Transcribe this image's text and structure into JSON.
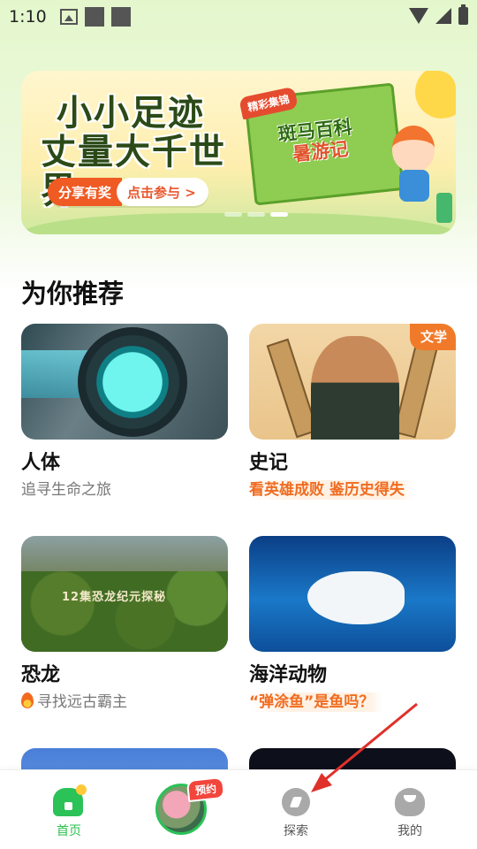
{
  "status_bar": {
    "time": "1:10"
  },
  "banner": {
    "title_line1": "小小足迹",
    "title_line2": "丈量大千世界",
    "share_label": "分享有奖",
    "join_label": "点击参与 >",
    "badge": "精彩集锦",
    "map_title_line1": "斑马百科",
    "map_title_line2": "暑游记",
    "slide_count": 3,
    "active_slide": 3
  },
  "section": {
    "title": "为你推荐"
  },
  "cards": [
    {
      "title": "人体",
      "subtitle": "追寻生命之旅"
    },
    {
      "title": "史记",
      "subtitle": "看英雄成败 鉴历史得失",
      "tag": "文学"
    },
    {
      "title": "恐龙",
      "subtitle": "寻找远古霸主",
      "thumb_caption": "12集恐龙纪元探秘"
    },
    {
      "title": "海洋动物",
      "subtitle": "“弹涂鱼”是鱼吗？"
    }
  ],
  "bottom_nav": {
    "items": [
      {
        "label": "首页",
        "icon": "home-icon",
        "active": true
      },
      {
        "label": "",
        "icon": "avatar",
        "badge": "预约"
      },
      {
        "label": "探索",
        "icon": "explore-icon"
      },
      {
        "label": "我的",
        "icon": "profile-icon"
      }
    ],
    "active_color": "#2bbf4c"
  },
  "colors": {
    "accent_green": "#2bc258",
    "accent_orange": "#f05a23",
    "highlight_text": "#f06c20"
  }
}
